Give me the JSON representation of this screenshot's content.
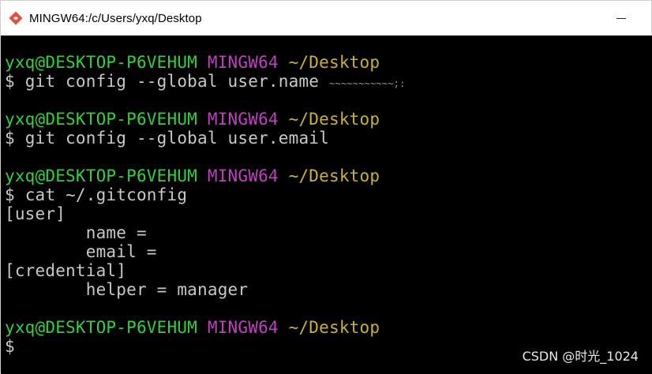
{
  "window": {
    "title": "MINGW64:/c/Users/yxq/Desktop",
    "app_icon": "git-icon",
    "minimize_icon": "minimize-icon"
  },
  "colors": {
    "background": "#000000",
    "prompt_user": "#2fd23a",
    "prompt_env": "#c23fc2",
    "prompt_path": "#c9b32a",
    "text": "#c8c8c8"
  },
  "terminal": {
    "prompt_user_host": "yxq@DESKTOP-P6VEHUM",
    "prompt_env": "MINGW64",
    "prompt_path": "~/Desktop",
    "prompt_symbol": "$",
    "commands": {
      "cmd1": "git config --global user.name",
      "cmd2": "git config --global user.email",
      "cmd3": "cat ~/.gitconfig"
    },
    "output": {
      "user_section": "[user]",
      "name_key": "        name =",
      "email_key": "        email =",
      "credential_section": "[credential]",
      "helper_line": "        helper = manager"
    }
  },
  "watermark": "CSDN @时光_1024"
}
